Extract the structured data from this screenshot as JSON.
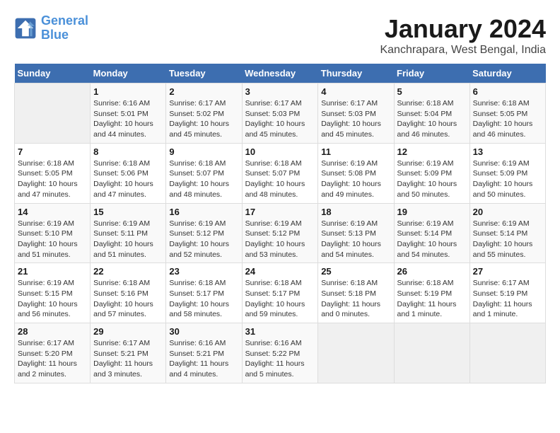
{
  "header": {
    "logo_line1": "General",
    "logo_line2": "Blue",
    "title": "January 2024",
    "subtitle": "Kanchrapara, West Bengal, India"
  },
  "calendar": {
    "days_of_week": [
      "Sunday",
      "Monday",
      "Tuesday",
      "Wednesday",
      "Thursday",
      "Friday",
      "Saturday"
    ],
    "weeks": [
      [
        {
          "day": "",
          "info": ""
        },
        {
          "day": "1",
          "info": "Sunrise: 6:16 AM\nSunset: 5:01 PM\nDaylight: 10 hours\nand 44 minutes."
        },
        {
          "day": "2",
          "info": "Sunrise: 6:17 AM\nSunset: 5:02 PM\nDaylight: 10 hours\nand 45 minutes."
        },
        {
          "day": "3",
          "info": "Sunrise: 6:17 AM\nSunset: 5:03 PM\nDaylight: 10 hours\nand 45 minutes."
        },
        {
          "day": "4",
          "info": "Sunrise: 6:17 AM\nSunset: 5:03 PM\nDaylight: 10 hours\nand 45 minutes."
        },
        {
          "day": "5",
          "info": "Sunrise: 6:18 AM\nSunset: 5:04 PM\nDaylight: 10 hours\nand 46 minutes."
        },
        {
          "day": "6",
          "info": "Sunrise: 6:18 AM\nSunset: 5:05 PM\nDaylight: 10 hours\nand 46 minutes."
        }
      ],
      [
        {
          "day": "7",
          "info": "Sunrise: 6:18 AM\nSunset: 5:05 PM\nDaylight: 10 hours\nand 47 minutes."
        },
        {
          "day": "8",
          "info": "Sunrise: 6:18 AM\nSunset: 5:06 PM\nDaylight: 10 hours\nand 47 minutes."
        },
        {
          "day": "9",
          "info": "Sunrise: 6:18 AM\nSunset: 5:07 PM\nDaylight: 10 hours\nand 48 minutes."
        },
        {
          "day": "10",
          "info": "Sunrise: 6:18 AM\nSunset: 5:07 PM\nDaylight: 10 hours\nand 48 minutes."
        },
        {
          "day": "11",
          "info": "Sunrise: 6:19 AM\nSunset: 5:08 PM\nDaylight: 10 hours\nand 49 minutes."
        },
        {
          "day": "12",
          "info": "Sunrise: 6:19 AM\nSunset: 5:09 PM\nDaylight: 10 hours\nand 50 minutes."
        },
        {
          "day": "13",
          "info": "Sunrise: 6:19 AM\nSunset: 5:09 PM\nDaylight: 10 hours\nand 50 minutes."
        }
      ],
      [
        {
          "day": "14",
          "info": "Sunrise: 6:19 AM\nSunset: 5:10 PM\nDaylight: 10 hours\nand 51 minutes."
        },
        {
          "day": "15",
          "info": "Sunrise: 6:19 AM\nSunset: 5:11 PM\nDaylight: 10 hours\nand 51 minutes."
        },
        {
          "day": "16",
          "info": "Sunrise: 6:19 AM\nSunset: 5:12 PM\nDaylight: 10 hours\nand 52 minutes."
        },
        {
          "day": "17",
          "info": "Sunrise: 6:19 AM\nSunset: 5:12 PM\nDaylight: 10 hours\nand 53 minutes."
        },
        {
          "day": "18",
          "info": "Sunrise: 6:19 AM\nSunset: 5:13 PM\nDaylight: 10 hours\nand 54 minutes."
        },
        {
          "day": "19",
          "info": "Sunrise: 6:19 AM\nSunset: 5:14 PM\nDaylight: 10 hours\nand 54 minutes."
        },
        {
          "day": "20",
          "info": "Sunrise: 6:19 AM\nSunset: 5:14 PM\nDaylight: 10 hours\nand 55 minutes."
        }
      ],
      [
        {
          "day": "21",
          "info": "Sunrise: 6:19 AM\nSunset: 5:15 PM\nDaylight: 10 hours\nand 56 minutes."
        },
        {
          "day": "22",
          "info": "Sunrise: 6:18 AM\nSunset: 5:16 PM\nDaylight: 10 hours\nand 57 minutes."
        },
        {
          "day": "23",
          "info": "Sunrise: 6:18 AM\nSunset: 5:17 PM\nDaylight: 10 hours\nand 58 minutes."
        },
        {
          "day": "24",
          "info": "Sunrise: 6:18 AM\nSunset: 5:17 PM\nDaylight: 10 hours\nand 59 minutes."
        },
        {
          "day": "25",
          "info": "Sunrise: 6:18 AM\nSunset: 5:18 PM\nDaylight: 11 hours\nand 0 minutes."
        },
        {
          "day": "26",
          "info": "Sunrise: 6:18 AM\nSunset: 5:19 PM\nDaylight: 11 hours\nand 1 minute."
        },
        {
          "day": "27",
          "info": "Sunrise: 6:17 AM\nSunset: 5:19 PM\nDaylight: 11 hours\nand 1 minute."
        }
      ],
      [
        {
          "day": "28",
          "info": "Sunrise: 6:17 AM\nSunset: 5:20 PM\nDaylight: 11 hours\nand 2 minutes."
        },
        {
          "day": "29",
          "info": "Sunrise: 6:17 AM\nSunset: 5:21 PM\nDaylight: 11 hours\nand 3 minutes."
        },
        {
          "day": "30",
          "info": "Sunrise: 6:16 AM\nSunset: 5:21 PM\nDaylight: 11 hours\nand 4 minutes."
        },
        {
          "day": "31",
          "info": "Sunrise: 6:16 AM\nSunset: 5:22 PM\nDaylight: 11 hours\nand 5 minutes."
        },
        {
          "day": "",
          "info": ""
        },
        {
          "day": "",
          "info": ""
        },
        {
          "day": "",
          "info": ""
        }
      ]
    ]
  }
}
